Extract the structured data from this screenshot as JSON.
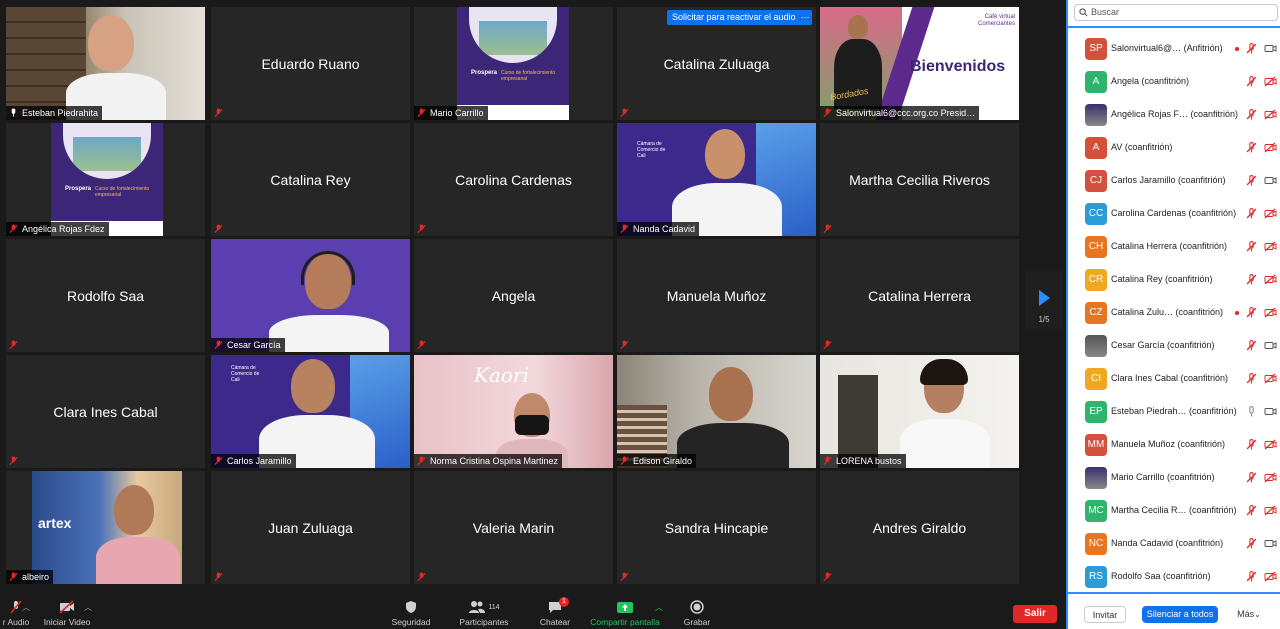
{
  "gallery": {
    "tiles": [
      {
        "label": "Esteban Piedrahita"
      },
      {
        "center": "Eduardo Ruano"
      },
      {
        "label": "Mario Carrillo",
        "image_title": "Prospera",
        "image_subtitle": "Curso de fortalecimiento empresarial"
      },
      {
        "center": "Catalina Zuluaga",
        "notice": "Solicitar para reactivar el audio",
        "notice_more": "···"
      },
      {
        "label": "Salonvirtual6@ccc.org.co Presid…",
        "banner": "Bienvenidos",
        "corner_text": "Café virtual\nComerciantes",
        "script_text": "Bordados"
      },
      {
        "label": "Angélica Rojas Fdez",
        "image_title": "Prospera",
        "image_subtitle": "Curso de fortalecimiento empresarial"
      },
      {
        "center": "Catalina Rey"
      },
      {
        "center": "Carolina Cardenas"
      },
      {
        "label": "Nanda Cadavid",
        "logo_text": "Cámara de Comercio de Cali"
      },
      {
        "center": "Martha Cecilia Riveros"
      },
      {
        "center": "Rodolfo Saa"
      },
      {
        "label": "Cesar García"
      },
      {
        "center": "Angela"
      },
      {
        "center": "Manuela Muñoz"
      },
      {
        "center": "Catalina Herrera"
      },
      {
        "center": "Clara Ines Cabal"
      },
      {
        "label": "Carlos Jaramillo",
        "logo_text": "Cámara de Comercio de Cali"
      },
      {
        "label": "Norma Cristina Ospina Martinez",
        "sign_text": "Kaori"
      },
      {
        "label": "Edison Giraldo"
      },
      {
        "label": "LORENA bustos"
      },
      {
        "label": "albeiro",
        "sign_text": "artex"
      },
      {
        "center": "Juan Zuluaga"
      },
      {
        "center": "Valeria Marin"
      },
      {
        "center": "Sandra Hincapie"
      },
      {
        "center": "Andres Giraldo"
      }
    ],
    "pager": "1/5"
  },
  "toolbar": {
    "audio": "r Audio",
    "video": "Iniciar Video",
    "security": "Seguridad",
    "participants": "Participantes",
    "participants_count": "114",
    "chat": "Chatear",
    "chat_badge": "1",
    "share": "Compartir pantalla",
    "record": "Grabar",
    "leave": "Salir"
  },
  "panel": {
    "search_placeholder": "Buscar",
    "participants": [
      {
        "initials": "SP",
        "color": "#d2503c",
        "name": "Salonvirtual6@… (Anfitrión)",
        "mic": "muted",
        "cam": "on",
        "dot": true
      },
      {
        "initials": "A",
        "color": "#2fb46c",
        "name": "Angela  (coanfitrión)",
        "mic": "muted",
        "cam": "off"
      },
      {
        "initials": "",
        "color": "#3b2f6b",
        "name": "Angélica Rojas F… (coanfitrión)",
        "mic": "muted",
        "cam": "off",
        "photo": true
      },
      {
        "initials": "A",
        "color": "#d2503c",
        "name": "AV (coanfitrión)",
        "mic": "muted",
        "cam": "off"
      },
      {
        "initials": "CJ",
        "color": "#d2503c",
        "name": "Carlos Jaramillo (coanfitrión)",
        "mic": "muted",
        "cam": "on"
      },
      {
        "initials": "CC",
        "color": "#2d9bd6",
        "name": "Carolina Cardenas (coanfitrión)",
        "mic": "muted",
        "cam": "off"
      },
      {
        "initials": "CH",
        "color": "#e8761e",
        "name": "Catalina Herrera (coanfitrión)",
        "mic": "muted",
        "cam": "off"
      },
      {
        "initials": "CR",
        "color": "#f0a820",
        "name": "Catalina Rey  (coanfitrión)",
        "mic": "muted",
        "cam": "off"
      },
      {
        "initials": "CZ",
        "color": "#e8761e",
        "name": "Catalina Zulu…  (coanfitrión)",
        "mic": "muted",
        "cam": "off",
        "dot": true
      },
      {
        "initials": "",
        "color": "#555555",
        "name": "Cesar García (coanfitrión)",
        "mic": "muted",
        "cam": "on",
        "photo": true
      },
      {
        "initials": "CI",
        "color": "#f0a820",
        "name": "Clara Ines Cabal (coanfitrión)",
        "mic": "muted",
        "cam": "off"
      },
      {
        "initials": "EP",
        "color": "#2fb46c",
        "name": "Esteban Piedrah…  (coanfitrión)",
        "mic": "on",
        "cam": "on"
      },
      {
        "initials": "MM",
        "color": "#d2503c",
        "name": "Manuela Muñoz (coanfitrión)",
        "mic": "muted",
        "cam": "off"
      },
      {
        "initials": "",
        "color": "#3b2f6b",
        "name": "Mario Carrillo (coanfitrión)",
        "mic": "muted",
        "cam": "off",
        "photo": true
      },
      {
        "initials": "MC",
        "color": "#2fb46c",
        "name": "Martha Cecilia R…  (coanfitrión)",
        "mic": "muted",
        "cam": "off"
      },
      {
        "initials": "NC",
        "color": "#e8761e",
        "name": "Nanda Cadavid (coanfitrión)",
        "mic": "muted",
        "cam": "on"
      },
      {
        "initials": "RS",
        "color": "#2d9bd6",
        "name": "Rodolfo Saa (coanfitrión)",
        "mic": "muted",
        "cam": "off"
      }
    ],
    "invite": "Invitar",
    "mute_all": "Silenciar a todos",
    "more": "Más"
  },
  "colors": {
    "accent": "#2d8cff",
    "leave": "#e02828",
    "speaker_outline": "#c9e35a",
    "muted_red": "#e02828"
  }
}
